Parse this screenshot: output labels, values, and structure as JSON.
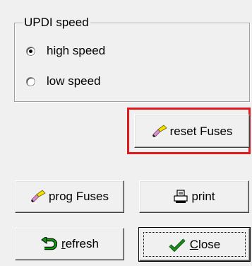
{
  "updi_speed": {
    "title": "UPDI speed",
    "options": [
      {
        "label": "high speed",
        "selected": true
      },
      {
        "label": "low speed",
        "selected": false
      }
    ]
  },
  "buttons": {
    "reset_fuses": {
      "label": "reset Fuses",
      "icon": "eraser-icon"
    },
    "prog_fuses": {
      "label": "prog Fuses",
      "icon": "eraser-icon"
    },
    "print": {
      "label": "print",
      "icon": "printer-icon"
    },
    "refresh": {
      "mnemonic": "r",
      "rest": "efresh",
      "icon": "refresh-arrow-icon"
    },
    "close": {
      "mnemonic": "C",
      "rest": "lose",
      "icon": "checkmark-icon"
    }
  },
  "colors": {
    "highlight": "#e0191e",
    "refresh_icon": "#0a9a0a",
    "checkmark_icon": "#1e8f1e"
  }
}
